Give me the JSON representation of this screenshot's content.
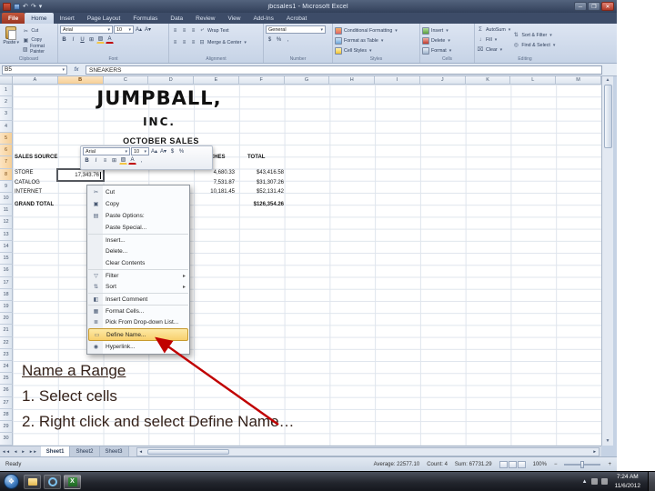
{
  "window": {
    "title": "jbcsales1 - Microsoft Excel"
  },
  "colors": {
    "arrow": "#c00000",
    "menu_highlight": "#f8cf6d",
    "file_tab": "#a83c28",
    "excel_green": "#1e6823"
  },
  "icons": {
    "undo": "↶",
    "redo": "↷",
    "dropdown": "▾",
    "minimize": "─",
    "maximize": "❐",
    "close": "✕",
    "cut": "✂",
    "copy": "▣",
    "format_painter": "▨",
    "grow_font": "A▴",
    "shrink_font": "A▾",
    "bold": "B",
    "italic": "I",
    "underline": "U",
    "borders": "⊞",
    "fill_color": "▨",
    "font_color": "A",
    "align": "≡",
    "wrap": "⤶",
    "merge": "⊟",
    "dollar": "$",
    "percent": "%",
    "comma": ",",
    "autosum": "Σ",
    "fill": "↓",
    "clear": "⌧",
    "sort": "⇅",
    "find": "◎",
    "fx": "fx",
    "start_flag": "❖",
    "tray_up": "▲",
    "nav_first": "◄◄",
    "nav_prev": "◄",
    "nav_next": "►",
    "nav_last": "►►",
    "scroll_up": "▲",
    "scroll_down": "▼",
    "scroll_left": "◄",
    "scroll_right": "►",
    "zoom_minus": "−",
    "zoom_plus": "+"
  },
  "ribbon_tabs": [
    {
      "label": "File"
    },
    {
      "label": "Home"
    },
    {
      "label": "Insert"
    },
    {
      "label": "Page Layout"
    },
    {
      "label": "Formulas"
    },
    {
      "label": "Data"
    },
    {
      "label": "Review"
    },
    {
      "label": "View"
    },
    {
      "label": "Add-Ins"
    },
    {
      "label": "Acrobat"
    }
  ],
  "ribbon": {
    "paste": "Paste",
    "cut": "Cut",
    "copy": "Copy",
    "format_painter": "Format Painter",
    "font_name": "Arial",
    "font_size": "10",
    "wrap_text": "Wrap Text",
    "merge_center": "Merge & Center",
    "number_format": "General",
    "conditional_formatting": "Conditional Formatting",
    "format_as_table": "Format as Table",
    "cell_styles": "Cell Styles",
    "insert": "Insert",
    "delete": "Delete",
    "format": "Format",
    "autosum": "AutoSum",
    "fill": "Fill",
    "clear": "Clear",
    "sort_filter": "Sort & Filter",
    "find_select": "Find & Select",
    "groups": [
      "Clipboard",
      "Font",
      "Alignment",
      "Number",
      "Styles",
      "Cells",
      "Editing"
    ]
  },
  "formula_bar": {
    "name_box": "B5",
    "value": "SNEAKERS"
  },
  "columns": [
    "A",
    "B",
    "C",
    "D",
    "E",
    "F",
    "G",
    "H",
    "I",
    "J",
    "K",
    "L",
    "M"
  ],
  "row_numbers": [
    "1",
    "2",
    "3",
    "4",
    "5",
    "6",
    "7",
    "8",
    "9",
    "10",
    "11",
    "12",
    "13",
    "14",
    "15",
    "16",
    "17",
    "18",
    "19",
    "20",
    "21",
    "22",
    "23",
    "24",
    "25",
    "26",
    "27",
    "28",
    "29",
    "30"
  ],
  "sheet": {
    "company_line1": "JUMPBALL,",
    "company_line2": "INC.",
    "report_title": "OCTOBER SALES",
    "header_source": "SALES SOURCE",
    "header_watches": "WATCHES",
    "header_total": "TOTAL",
    "row_store": "STORE",
    "row_catalog": "CATALOG",
    "row_internet": "INTERNET",
    "row_grand_total": "GRAND TOTAL",
    "edit_value": "17,343.76",
    "store_watches": "4,680.33",
    "store_total": "$43,416.58",
    "catalog_watches": "7,531.87",
    "catalog_total": "$31,307.26",
    "internet_watches": "10,181.45",
    "internet_total": "$52,131.42",
    "grand_total": "$126,354.26"
  },
  "mini_toolbar": {
    "font": "Arial",
    "size": "10"
  },
  "context_menu": {
    "items": [
      {
        "glyph": "✂",
        "label": "Cut",
        "arrow": ""
      },
      {
        "glyph": "▣",
        "label": "Copy",
        "arrow": ""
      },
      {
        "glyph": "▤",
        "label": "Paste Options:",
        "arrow": ""
      },
      {
        "glyph": "",
        "label": "Paste Special...",
        "arrow": ""
      },
      {
        "glyph": "",
        "label": "Insert...",
        "arrow": ""
      },
      {
        "glyph": "",
        "label": "Delete...",
        "arrow": ""
      },
      {
        "glyph": "",
        "label": "Clear Contents",
        "arrow": ""
      },
      {
        "glyph": "▽",
        "label": "Filter",
        "arrow": "▸"
      },
      {
        "glyph": "⇅",
        "label": "Sort",
        "arrow": "▸"
      },
      {
        "glyph": "◧",
        "label": "Insert Comment",
        "arrow": ""
      },
      {
        "glyph": "▦",
        "label": "Format Cells...",
        "arrow": ""
      },
      {
        "glyph": "≣",
        "label": "Pick From Drop-down List...",
        "arrow": ""
      },
      {
        "glyph": "▭",
        "label": "Define Name...",
        "arrow": ""
      },
      {
        "glyph": "◉",
        "label": "Hyperlink...",
        "arrow": ""
      }
    ]
  },
  "annotation": {
    "title": "Name a Range",
    "step1": "1. Select cells",
    "step2": "2. Right click and select Define Name…"
  },
  "sheet_tabs": [
    {
      "label": "Sheet1"
    },
    {
      "label": "Sheet2"
    },
    {
      "label": "Sheet3"
    }
  ],
  "status_bar": {
    "mode": "Ready",
    "average": "Average: 22577.10",
    "count": "Count: 4",
    "sum": "Sum: 67731.29",
    "zoom": "100%"
  },
  "taskbar": {
    "time": "7:24 AM",
    "date": "11/6/2012"
  }
}
